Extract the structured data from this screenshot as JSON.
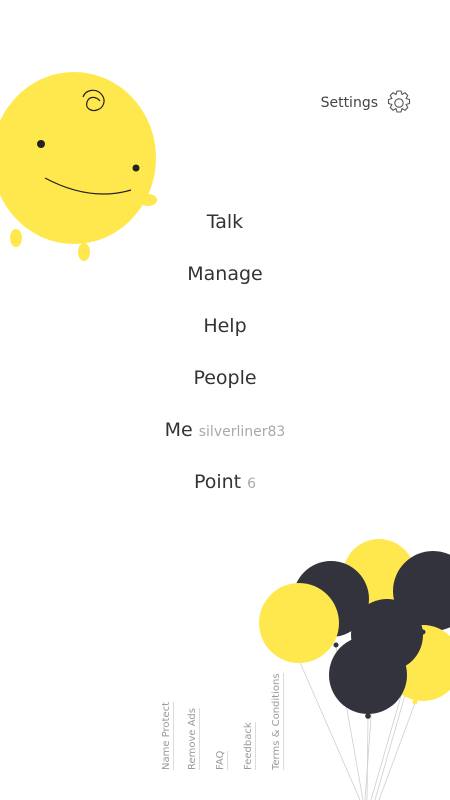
{
  "settings": {
    "label": "Settings",
    "icon": "gear-icon"
  },
  "menu": {
    "talk": "Talk",
    "manage": "Manage",
    "help": "Help",
    "people": "People",
    "me": {
      "label": "Me",
      "value": "silverliner83"
    },
    "point": {
      "label": "Point",
      "value": "6"
    }
  },
  "footer": {
    "name_protect": "Name Protect",
    "remove_ads": "Remove Ads",
    "faq": "FAQ",
    "feedback": "Feedback",
    "terms": "Terms & Conditions"
  },
  "colors": {
    "accent_yellow": "#FFE84E",
    "balloon_dark": "#32333C",
    "text": "#333333",
    "muted": "#A9A9A9"
  }
}
